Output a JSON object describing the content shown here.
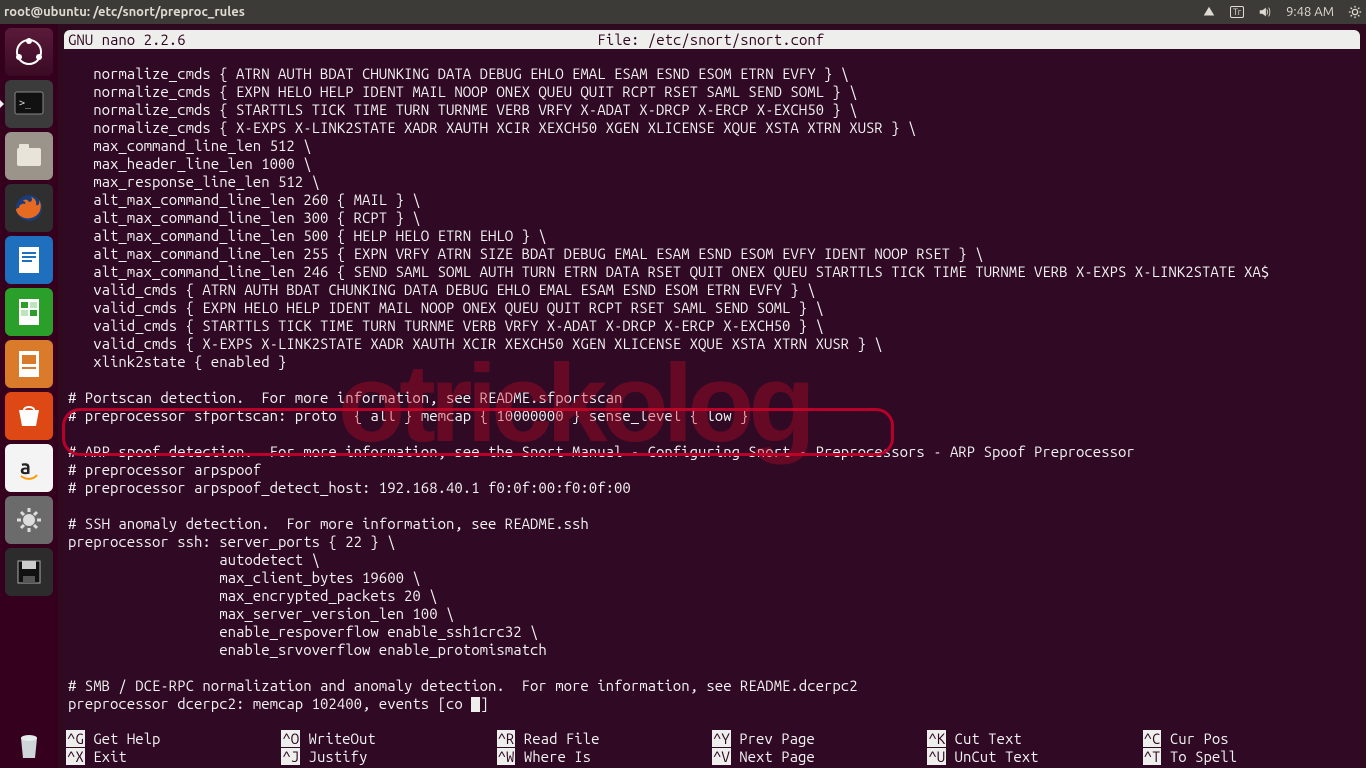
{
  "menubar": {
    "title": "root@ubuntu: /etc/snort/preproc_rules",
    "keyboard_layout": "Tr",
    "time": "9:48 AM"
  },
  "launcher": {
    "items": [
      {
        "name": "dash",
        "color": "#4a1231"
      },
      {
        "name": "terminal",
        "color": "#3a3a3a",
        "active": true
      },
      {
        "name": "files",
        "color": "#8a8782"
      },
      {
        "name": "firefox",
        "color": "#2a2a2a"
      },
      {
        "name": "writer",
        "color": "#1f6fbf"
      },
      {
        "name": "calc",
        "color": "#2aa02a"
      },
      {
        "name": "impress",
        "color": "#d97b2a"
      },
      {
        "name": "software",
        "color": "#e95420"
      },
      {
        "name": "amazon",
        "color": "#f2f2f2"
      },
      {
        "name": "settings",
        "color": "#6a6a6a"
      },
      {
        "name": "save",
        "color": "#2a2a2a"
      }
    ],
    "trash": {
      "name": "trash"
    }
  },
  "nano": {
    "version": "  GNU nano 2.2.6",
    "file_label": "File: /etc/snort/snort.conf",
    "lines": [
      "   normalize_cmds { ATRN AUTH BDAT CHUNKING DATA DEBUG EHLO EMAL ESAM ESND ESOM ETRN EVFY } \\",
      "   normalize_cmds { EXPN HELO HELP IDENT MAIL NOOP ONEX QUEU QUIT RCPT RSET SAML SEND SOML } \\",
      "   normalize_cmds { STARTTLS TICK TIME TURN TURNME VERB VRFY X-ADAT X-DRCP X-ERCP X-EXCH50 } \\",
      "   normalize_cmds { X-EXPS X-LINK2STATE XADR XAUTH XCIR XEXCH50 XGEN XLICENSE XQUE XSTA XTRN XUSR } \\",
      "   max_command_line_len 512 \\",
      "   max_header_line_len 1000 \\",
      "   max_response_line_len 512 \\",
      "   alt_max_command_line_len 260 { MAIL } \\",
      "   alt_max_command_line_len 300 { RCPT } \\",
      "   alt_max_command_line_len 500 { HELP HELO ETRN EHLO } \\",
      "   alt_max_command_line_len 255 { EXPN VRFY ATRN SIZE BDAT DEBUG EMAL ESAM ESND ESOM EVFY IDENT NOOP RSET } \\",
      "   alt_max_command_line_len 246 { SEND SAML SOML AUTH TURN ETRN DATA RSET QUIT ONEX QUEU STARTTLS TICK TIME TURNME VERB X-EXPS X-LINK2STATE XA$",
      "   valid_cmds { ATRN AUTH BDAT CHUNKING DATA DEBUG EHLO EMAL ESAM ESND ESOM ETRN EVFY } \\",
      "   valid_cmds { EXPN HELO HELP IDENT MAIL NOOP ONEX QUEU QUIT RCPT RSET SAML SEND SOML } \\",
      "   valid_cmds { STARTTLS TICK TIME TURN TURNME VERB VRFY X-ADAT X-DRCP X-ERCP X-EXCH50 } \\",
      "   valid_cmds { X-EXPS X-LINK2STATE XADR XAUTH XCIR XEXCH50 XGEN XLICENSE XQUE XSTA XTRN XUSR } \\",
      "   xlink2state { enabled }",
      "",
      "# Portscan detection.  For more information, see README.sfportscan",
      "# preprocessor sfportscan: proto  { all } memcap { 10000000 } sense_level { low }",
      "",
      "# ARP spoof detection.  For more information, see the Snort Manual - Configuring Snort - Preprocessors - ARP Spoof Preprocessor",
      "# preprocessor arpspoof",
      "# preprocessor arpspoof_detect_host: 192.168.40.1 f0:0f:00:f0:0f:00",
      "",
      "# SSH anomaly detection.  For more information, see README.ssh",
      "preprocessor ssh: server_ports { 22 } \\",
      "                  autodetect \\",
      "                  max_client_bytes 19600 \\",
      "                  max_encrypted_packets 20 \\",
      "                  max_server_version_len 100 \\",
      "                  enable_respoverflow enable_ssh1crc32 \\",
      "                  enable_srvoverflow enable_protomismatch",
      "",
      "# SMB / DCE-RPC normalization and anomaly detection.  For more information, see README.dcerpc2",
      "preprocessor dcerpc2: memcap 102400, events [co "
    ],
    "help": [
      {
        "k": "^G",
        "t": " Get Help"
      },
      {
        "k": "^O",
        "t": " WriteOut"
      },
      {
        "k": "^R",
        "t": " Read File"
      },
      {
        "k": "^Y",
        "t": " Prev Page"
      },
      {
        "k": "^K",
        "t": " Cut Text"
      },
      {
        "k": "^C",
        "t": " Cur Pos"
      },
      {
        "k": "^X",
        "t": " Exit"
      },
      {
        "k": "^J",
        "t": " Justify"
      },
      {
        "k": "^W",
        "t": " Where Is"
      },
      {
        "k": "^V",
        "t": " Next Page"
      },
      {
        "k": "^U",
        "t": " UnCut Text"
      },
      {
        "k": "^T",
        "t": " To Spell"
      }
    ]
  },
  "annotation": {
    "watermark": "otrickolog"
  }
}
